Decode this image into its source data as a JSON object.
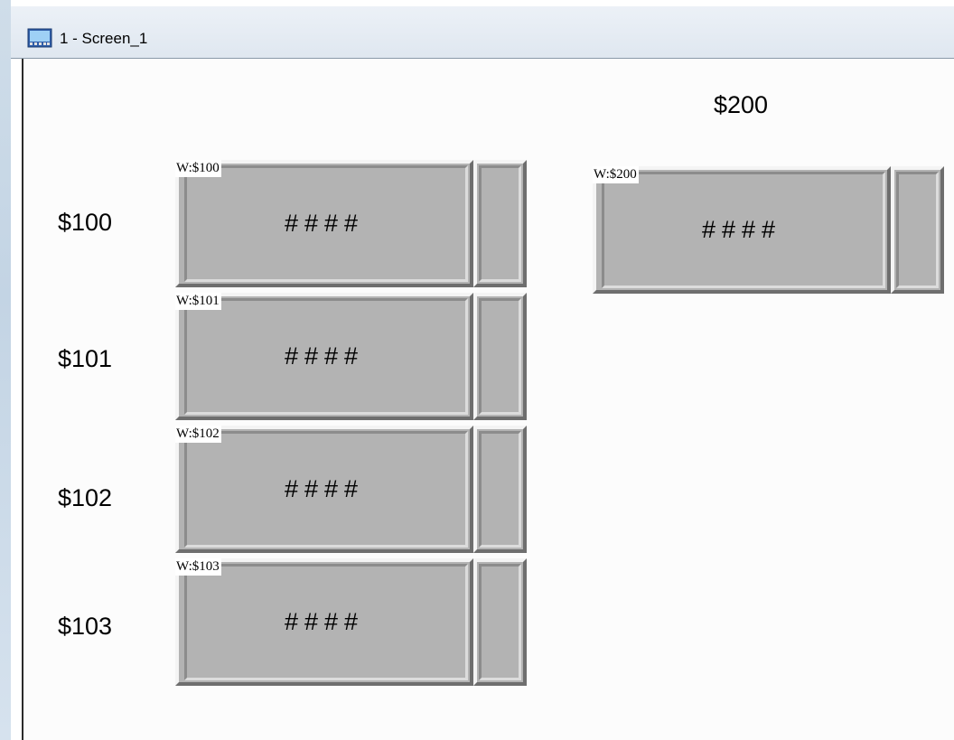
{
  "window": {
    "title": "1 - Screen_1",
    "icon": "screen-monitor-icon"
  },
  "labels": {
    "top_right": "$200",
    "row_100": "$100",
    "row_101": "$101",
    "row_102": "$102",
    "row_103": "$103"
  },
  "controls": [
    {
      "tag": "W:$100",
      "value": "####"
    },
    {
      "tag": "W:$101",
      "value": "####"
    },
    {
      "tag": "W:$102",
      "value": "####"
    },
    {
      "tag": "W:$103",
      "value": "####"
    },
    {
      "tag": "W:$200",
      "value": "####"
    }
  ]
}
